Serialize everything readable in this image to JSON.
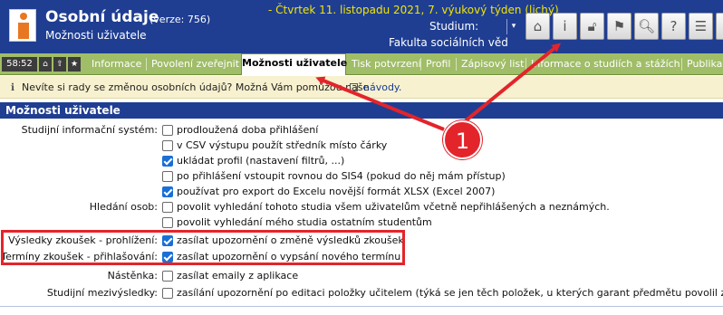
{
  "header": {
    "title": "Osobní údaje",
    "version": "(verze: 756)",
    "subtitle": "Možnosti uživatele",
    "date": "- Čtvrtek 11. listopadu 2021, 7. výukový týden (lichý)",
    "studium_label": "Studium:",
    "faculty": "Fakulta sociálních věd",
    "icons": [
      "home-icon",
      "info-book-icon",
      "lock-icon",
      "flag-icon",
      "abc-search-icon",
      "help-icon",
      "chat-icon",
      "bell-icon"
    ]
  },
  "menubar": {
    "clock": "58:52",
    "items": [
      "Informace",
      "Povolení zveřejnit",
      "Možnosti uživatele",
      "Tisk potvrzení",
      "Profil",
      "Zápisový list",
      "Informace o studiích a stážích",
      "Publika"
    ]
  },
  "info": {
    "text": "Nevíte si rady se změnou osobních údajů? Možná Vám pomůžou naše",
    "link": "návody."
  },
  "section": {
    "title": "Možnosti uživatele",
    "rows": [
      {
        "label": "Studijní informační systém:",
        "option": "prodloužená doba přihlášení",
        "checked": false
      },
      {
        "label": "",
        "option": "v CSV výstupu použít středník místo čárky",
        "checked": false
      },
      {
        "label": "",
        "option": "ukládat profil (nastavení filtrů, ...)",
        "checked": true
      },
      {
        "label": "",
        "option": "po přihlášení vstoupit rovnou do SIS4 (pokud do něj mám přístup)",
        "checked": false
      },
      {
        "label": "",
        "option": "používat pro export do Excelu novější formát XLSX (Excel 2007)",
        "checked": true
      },
      {
        "label": "Hledání osob:",
        "option": "povolit vyhledání tohoto studia všem uživatelům včetně nepřihlášených a neznámých.",
        "checked": false
      },
      {
        "label": "",
        "option": "povolit vyhledání mého studia ostatním studentům",
        "checked": false
      },
      {
        "label": "Výsledky zkoušek - prohlížení:",
        "option": "zasílat upozornění o změně výsledků zkoušek",
        "checked": true
      },
      {
        "label": "Termíny zkoušek - přihlašování:",
        "option": "zasílat upozornění o vypsání nového termínu",
        "checked": true
      },
      {
        "label": "Nástěnka:",
        "option": "zasílat emaily z aplikace",
        "checked": false
      },
      {
        "label": "Studijní mezivýsledky:",
        "option": "zasílání upozornění po editaci položky učitelem (týká se jen těch položek, u kterých garant předmětu povolil zasí",
        "checked": false
      }
    ]
  },
  "annotation": {
    "badge": "1",
    "color": "#e3242b"
  },
  "colors": {
    "header_blue": "#1f3e92",
    "menu_green": "#a0bd67",
    "date_yellow": "#f2e500",
    "checkbox_blue": "#1a6fd6"
  }
}
